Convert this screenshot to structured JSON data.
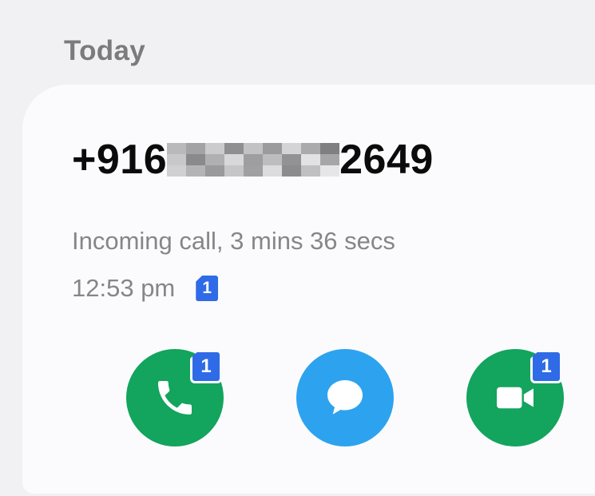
{
  "section": {
    "header": "Today"
  },
  "call_log": {
    "number_prefix": "+916",
    "number_suffix": "2649",
    "call_type_duration": "Incoming call, 3 mins 36 secs",
    "time": "12:53 pm",
    "sim_label": "1"
  },
  "actions": {
    "call": {
      "icon": "phone-icon",
      "badge": "1",
      "color": "#13a45d"
    },
    "message": {
      "icon": "message-bubble-icon",
      "color": "#2da3ef"
    },
    "video": {
      "icon": "video-camera-icon",
      "badge": "1",
      "color": "#13a45d"
    }
  },
  "colors": {
    "sim_badge": "#2f6be6",
    "background": "#f1f1f3",
    "card": "#fbfbfd"
  }
}
